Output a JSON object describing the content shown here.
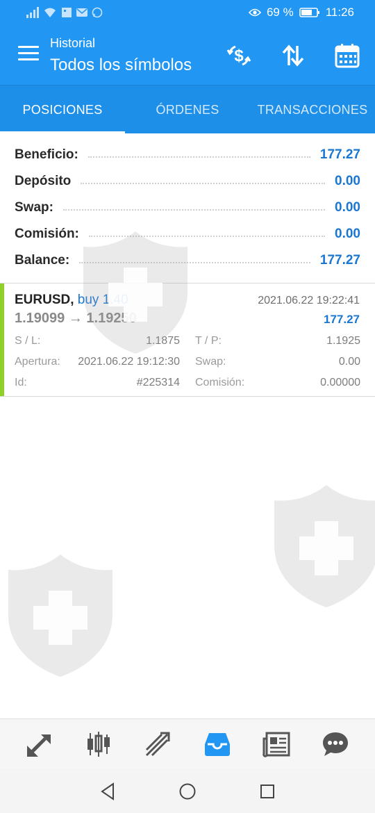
{
  "status_bar": {
    "battery": "69 %",
    "time": "11:26",
    "icons": [
      "signal-icon",
      "wifi-icon",
      "image-icon",
      "mail-icon",
      "whatsapp-icon",
      "eye-icon",
      "battery-icon"
    ]
  },
  "app_bar": {
    "subtitle": "Historial",
    "title": "Todos los símbolos",
    "icons": [
      "menu-icon",
      "currency-exchange-icon",
      "sort-icon",
      "calendar-icon"
    ]
  },
  "tabs": [
    {
      "label": "POSICIONES",
      "active": true
    },
    {
      "label": "ÓRDENES",
      "active": false
    },
    {
      "label": "TRANSACCIONES",
      "active": false
    }
  ],
  "summary": [
    {
      "label": "Beneficio:",
      "value": "177.27"
    },
    {
      "label": "Depósito",
      "value": "0.00"
    },
    {
      "label": "Swap:",
      "value": "0.00"
    },
    {
      "label": "Comisión:",
      "value": "0.00"
    },
    {
      "label": "Balance:",
      "value": "177.27"
    }
  ],
  "position": {
    "symbol": "EURUSD,",
    "side": "buy 1.40",
    "time": "2021.06.22 19:22:41",
    "prices": "1.19099 → 1.19250",
    "profit": "177.27",
    "details": [
      {
        "l1": "S / L:",
        "v1": "1.1875",
        "l2": "T / P:",
        "v2": "1.1925"
      },
      {
        "l1": "Apertura:",
        "v1": "2021.06.22 19:12:30",
        "l2": "Swap:",
        "v2": "0.00"
      },
      {
        "l1": "Id:",
        "v1": "#225314",
        "l2": "Comisión:",
        "v2": "0.00000"
      }
    ]
  },
  "bottom_nav": [
    "quotes-icon",
    "chart-icon",
    "trade-icon",
    "history-icon",
    "news-icon",
    "chat-icon"
  ],
  "active_bottom_nav": "history-icon",
  "system_nav": [
    "back-icon",
    "home-icon",
    "recents-icon"
  ],
  "colors": {
    "primary": "#2196f3",
    "tab_bar": "#1e8fe8",
    "value_blue": "#1976d2",
    "buy_bar": "#8fd12a",
    "nav_active": "#2196f3",
    "nav_inactive": "#555555"
  }
}
